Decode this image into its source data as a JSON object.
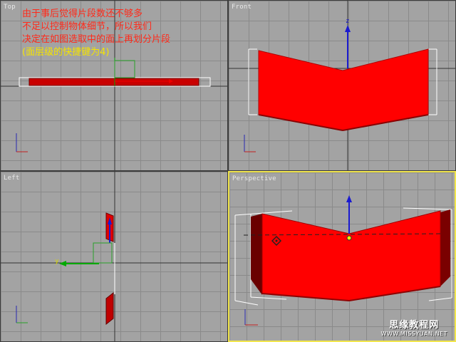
{
  "viewports": {
    "top": {
      "label": "Top"
    },
    "front": {
      "label": "Front"
    },
    "left": {
      "label": "Left"
    },
    "perspective": {
      "label": "Perspective"
    }
  },
  "note": {
    "line1": "由于事后觉得片段数还不够多",
    "line2": "不足以控制物体细节，所以我们",
    "line3": "决定在如图选取中的面上再划分片段",
    "line4": "(面层级的快捷键为4)"
  },
  "axes": {
    "x": "x",
    "y": "y",
    "z": "z"
  },
  "watermark": {
    "title": "思缘教程网",
    "url": "WWW.MISSYUAN.NET"
  },
  "colors": {
    "viewport_bg": "#a3a3a3",
    "grid": "#8a8a8a",
    "active_border": "#f2e64d",
    "object": "#ff0000",
    "note_red": "#ff2a1a",
    "note_yellow": "#f5e400"
  }
}
